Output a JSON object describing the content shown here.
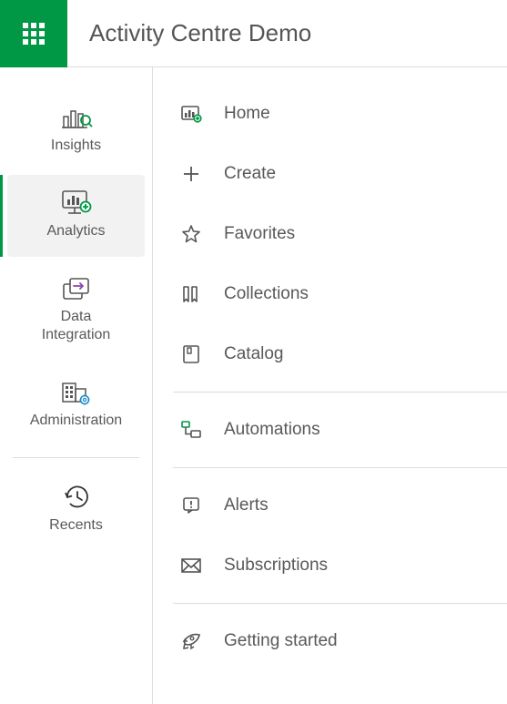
{
  "app": {
    "title": "Activity Centre Demo"
  },
  "sidebar": {
    "items": [
      {
        "label": "Insights"
      },
      {
        "label": "Analytics"
      },
      {
        "label": "Data\nIntegration"
      },
      {
        "label": "Administration"
      },
      {
        "label": "Recents"
      }
    ],
    "activeIndex": 1
  },
  "menu": {
    "items": [
      {
        "label": "Home"
      },
      {
        "label": "Create"
      },
      {
        "label": "Favorites"
      },
      {
        "label": "Collections"
      },
      {
        "label": "Catalog"
      },
      {
        "label": "Automations"
      },
      {
        "label": "Alerts"
      },
      {
        "label": "Subscriptions"
      },
      {
        "label": "Getting started"
      }
    ]
  }
}
